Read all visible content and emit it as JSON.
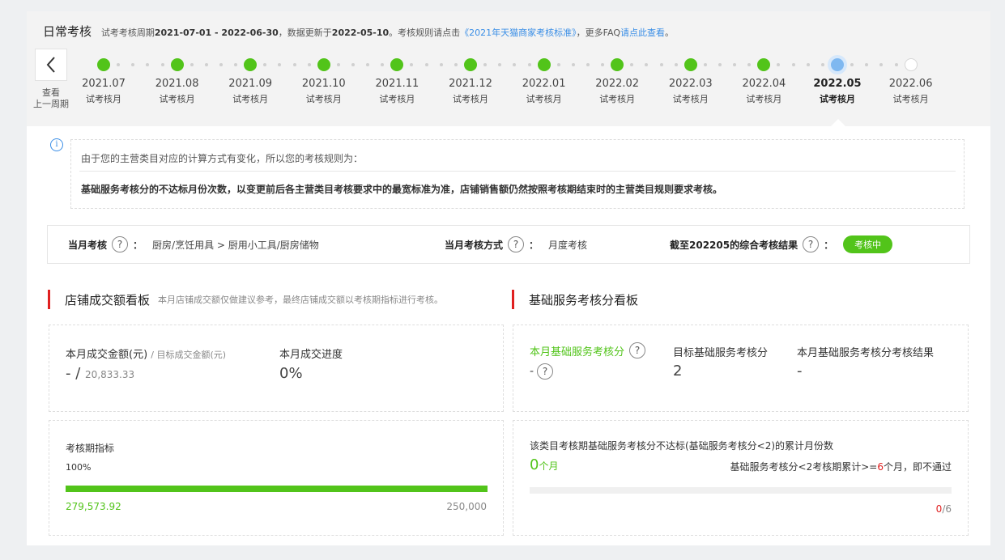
{
  "header": {
    "title": "日常考核",
    "period_prefix": "试考考核周期",
    "period": "2021-07-01 - 2022-06-30",
    "update_prefix": "，数据更新于",
    "update_date": "2022-05-10",
    "rule_prefix": "。考核规则请点击",
    "rule_link": "《2021年天猫商家考核标准》",
    "faq_prefix": "，更多FAQ",
    "faq_link": "请点此查看",
    "faq_suffix": "。"
  },
  "prev_period": {
    "line1": "查看",
    "line2": "上一周期"
  },
  "timeline": [
    {
      "month": "2021.07",
      "label": "试考核月",
      "status": "done"
    },
    {
      "month": "2021.08",
      "label": "试考核月",
      "status": "done"
    },
    {
      "month": "2021.09",
      "label": "试考核月",
      "status": "done"
    },
    {
      "month": "2021.10",
      "label": "试考核月",
      "status": "done"
    },
    {
      "month": "2021.11",
      "label": "试考核月",
      "status": "done"
    },
    {
      "month": "2021.12",
      "label": "试考核月",
      "status": "done"
    },
    {
      "month": "2022.01",
      "label": "试考核月",
      "status": "done"
    },
    {
      "month": "2022.02",
      "label": "试考核月",
      "status": "done"
    },
    {
      "month": "2022.03",
      "label": "试考核月",
      "status": "done"
    },
    {
      "month": "2022.04",
      "label": "试考核月",
      "status": "done"
    },
    {
      "month": "2022.05",
      "label": "试考核月",
      "status": "current"
    },
    {
      "month": "2022.06",
      "label": "试考核月",
      "status": "future"
    }
  ],
  "notice": {
    "line1": "由于您的主营类目对应的计算方式有变化，所以您的考核规则为：",
    "line2": "基础服务考核分的不达标月份次数，以变更前后各主营类目考核要求中的最宽标准为准，店铺销售额仍然按照考核期结束时的主营类目规则要求考核。"
  },
  "infobar": {
    "month_label": "当月考核",
    "month_value": "厨房/烹饪用具 > 厨用小工具/厨房储物",
    "method_label": "当月考核方式",
    "method_value": "月度考核",
    "result_label": "截至202205的综合考核结果",
    "result_badge": "考核中",
    "colon": "："
  },
  "sales_board": {
    "title": "店铺成交额看板",
    "desc": "本月店铺成交额仅做建议参考，最终店铺成交额以考核期指标进行考核。",
    "amount_label": "本月成交金额(元)",
    "target_label": "/ 目标成交金额(元)",
    "amount_value": "-",
    "amount_sep": "/",
    "target_value": "20,833.33",
    "progress_label": "本月成交进度",
    "progress_value": "0%",
    "period_label": "考核期指标",
    "period_percent": "100%",
    "period_fill": 1.0,
    "period_actual": "279,573.92",
    "period_target": "250,000"
  },
  "service_board": {
    "title": "基础服务考核分看板",
    "score_label": "本月基础服务考核分",
    "score_value": "-",
    "target_label": "目标基础服务考核分",
    "target_value": "2",
    "result_label": "本月基础服务考核分考核结果",
    "result_value": "-",
    "fail_title": "该类目考核期基础服务考核分不达标(基础服务考核分<2)的累计月份数",
    "fail_count": "0",
    "fail_unit": "个月",
    "rule_prefix": "基础服务考核分<2考核期累计>=",
    "rule_num": "6",
    "rule_suffix": "个月，即不通过",
    "ratio_num": "0",
    "ratio_den": "/6",
    "fail_fill": 0
  },
  "colors": {
    "accent": "#52c41a",
    "link": "#3a8ee6",
    "danger": "#e02020"
  }
}
